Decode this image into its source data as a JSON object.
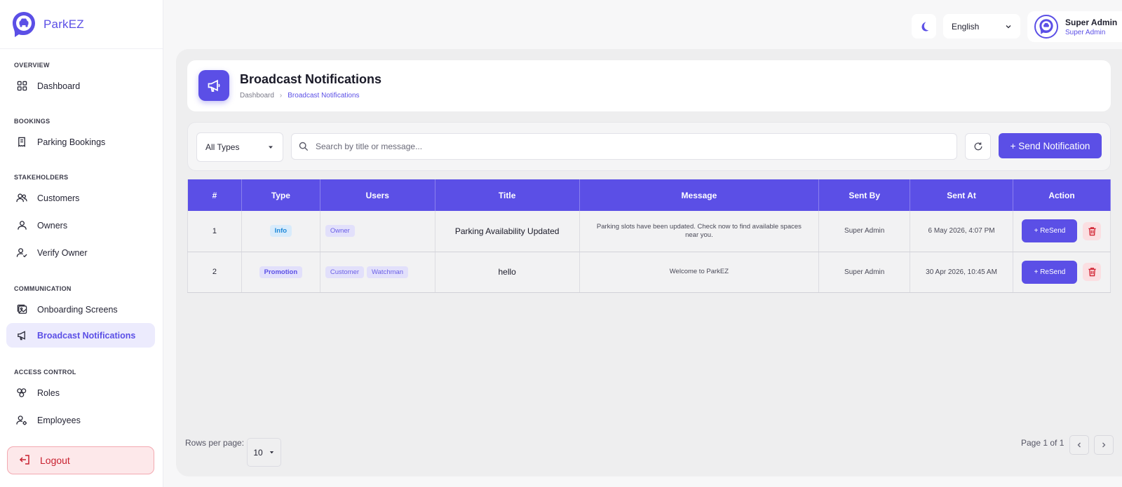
{
  "brand": {
    "name": "ParkEZ"
  },
  "sidebar": {
    "sections": [
      {
        "title": "OVERVIEW",
        "items": [
          {
            "label": "Dashboard",
            "icon": "grid-icon"
          }
        ]
      },
      {
        "title": "BOOKINGS",
        "items": [
          {
            "label": "Parking Bookings",
            "icon": "receipt-icon"
          }
        ]
      },
      {
        "title": "STAKEHOLDERS",
        "items": [
          {
            "label": "Customers",
            "icon": "users-icon"
          },
          {
            "label": "Owners",
            "icon": "user-icon"
          },
          {
            "label": "Verify Owner",
            "icon": "user-check-icon"
          }
        ]
      },
      {
        "title": "COMMUNICATION",
        "items": [
          {
            "label": "Onboarding Screens",
            "icon": "images-icon"
          },
          {
            "label": "Broadcast Notifications",
            "icon": "megaphone-icon",
            "active": true
          }
        ]
      },
      {
        "title": "ACCESS CONTROL",
        "items": [
          {
            "label": "Roles",
            "icon": "roles-icon"
          },
          {
            "label": "Employees",
            "icon": "employee-icon"
          }
        ]
      }
    ],
    "logout_label": "Logout"
  },
  "topbar": {
    "language": "English",
    "user": {
      "name": "Super Admin",
      "role": "Super Admin"
    }
  },
  "header": {
    "title": "Broadcast Notifications",
    "breadcrumb": {
      "home": "Dashboard",
      "current": "Broadcast Notifications"
    }
  },
  "filters": {
    "type_selected": "All Types",
    "search_placeholder": "Search by title or message...",
    "send_label": "+ Send Notification"
  },
  "table": {
    "columns": [
      "#",
      "Type",
      "Users",
      "Title",
      "Message",
      "Sent By",
      "Sent At",
      "Action"
    ],
    "rows": [
      {
        "index": "1",
        "type": "Info",
        "users": [
          "Owner"
        ],
        "title": "Parking Availability Updated",
        "message": "Parking slots have been updated. Check now to find available spaces near you.",
        "sent_by": "Super Admin",
        "sent_at": "6 May 2026, 4:07 PM",
        "action_label": "+ ReSend"
      },
      {
        "index": "2",
        "type": "Promotion",
        "users": [
          "Customer",
          "Watchman"
        ],
        "title": "hello",
        "message": "Welcome to ParkEZ",
        "sent_by": "Super Admin",
        "sent_at": "30 Apr 2026, 10:45 AM",
        "action_label": "+ ReSend"
      }
    ]
  },
  "pagination": {
    "rows_label": "Rows per page:",
    "rows_value": "10",
    "page_info": "Page 1 of 1"
  },
  "colors": {
    "accent": "#5b4fe6",
    "danger": "#c8202f"
  }
}
